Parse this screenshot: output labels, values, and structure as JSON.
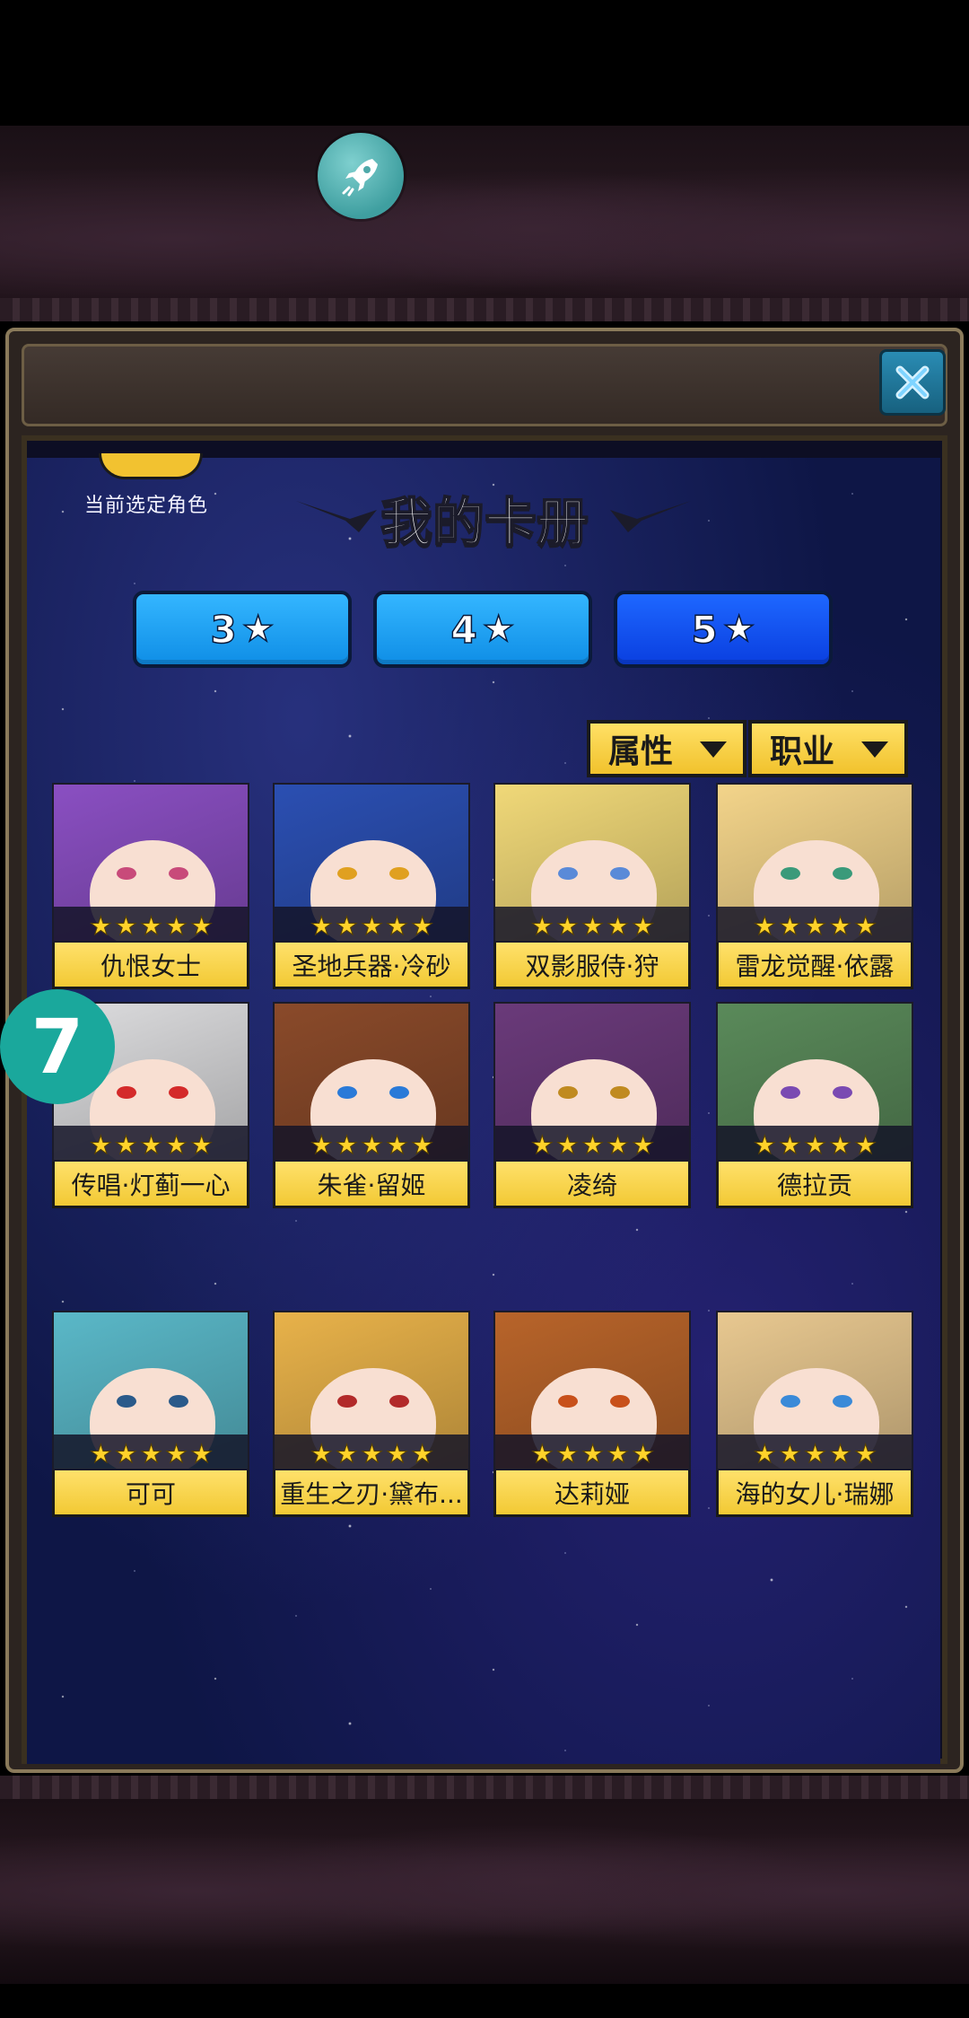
{
  "window": {
    "title": "我的卡册"
  },
  "current_role": {
    "label": "当前选定角色"
  },
  "tabs": [
    {
      "label": "3",
      "active": false
    },
    {
      "label": "4",
      "active": false
    },
    {
      "label": "5",
      "active": true
    }
  ],
  "filters": [
    {
      "label": "属性"
    },
    {
      "label": "职业"
    }
  ],
  "star_glyph": "★",
  "cards": [
    {
      "name": "仇恨女士",
      "stars": "★★★★★",
      "hair": "#8a4fc2",
      "eyes": "#c84a7a"
    },
    {
      "name": "圣地兵器·冷砂",
      "stars": "★★★★★",
      "hair": "#2b4fb2",
      "eyes": "#e0a020"
    },
    {
      "name": "双影服侍·狩",
      "stars": "★★★★★",
      "hair": "#f0d878",
      "eyes": "#5a8ad8"
    },
    {
      "name": "雷龙觉醒·依露",
      "stars": "★★★★★",
      "hair": "#f3d48a",
      "eyes": "#3a9a7a"
    },
    {
      "name": "传唱·灯蓟一心",
      "stars": "★★★★★",
      "hair": "#dcdcde",
      "eyes": "#d42a2a"
    },
    {
      "name": "朱雀·留姬",
      "stars": "★★★★★",
      "hair": "#8a4a2a",
      "eyes": "#2a7ad8"
    },
    {
      "name": "凌绮",
      "stars": "★★★★★",
      "hair": "#6a3a7a",
      "eyes": "#c08a20"
    },
    {
      "name": "德拉贡",
      "stars": "★★★★★",
      "hair": "#5a8a5a",
      "eyes": "#7a4ab2"
    },
    {
      "name": "可可",
      "stars": "★★★★★",
      "hair": "#5ab8c8",
      "eyes": "#2a5a8a"
    },
    {
      "name": "重生之刃·黛布...",
      "stars": "★★★★★",
      "hair": "#e8b24a",
      "eyes": "#b22a2a"
    },
    {
      "name": "达莉娅",
      "stars": "★★★★★",
      "hair": "#b8642a",
      "eyes": "#c8501a"
    },
    {
      "name": "海的女儿·瑞娜",
      "stars": "★★★★★",
      "hair": "#e8c890",
      "eyes": "#3a8ad8"
    }
  ],
  "side_badge": {
    "label": "7"
  },
  "colors": {
    "tab_blue": "#1aa0f5",
    "tab_active": "#0a4ae6",
    "gold": "#f2c934",
    "close_teal": "#1f7fa6",
    "rocket": "#5ab5b5",
    "badge_teal": "#1aa89c"
  },
  "icons": {
    "rocket": "rocket-icon",
    "close": "close-icon",
    "star": "star-icon",
    "dropdown": "dropdown-arrow-icon",
    "controller": "gamepad-icon"
  }
}
